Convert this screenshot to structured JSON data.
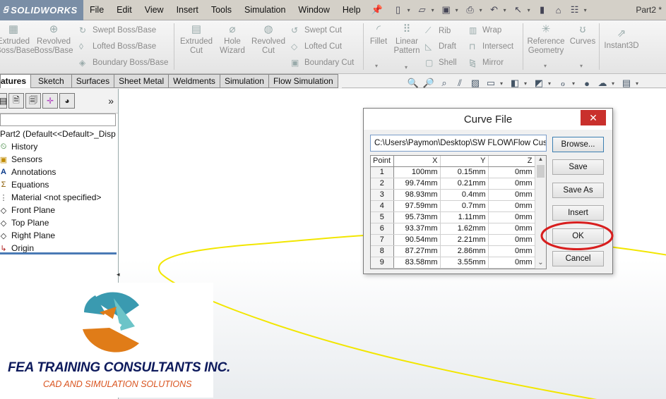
{
  "app": {
    "logo_brand": "SOLIDWORKS",
    "document_title": "Part2 *"
  },
  "menu": [
    "File",
    "Edit",
    "View",
    "Insert",
    "Tools",
    "Simulation",
    "Window",
    "Help"
  ],
  "command_manager": {
    "extruded_boss": "Extruded\nBoss/Base",
    "revolved_boss": "Revolved\nBoss/Base",
    "swept_boss": "Swept Boss/Base",
    "lofted_boss": "Lofted Boss/Base",
    "boundary_boss": "Boundary Boss/Base",
    "extruded_cut": "Extruded\nCut",
    "hole_wizard": "Hole\nWizard",
    "revolved_cut": "Revolved\nCut",
    "swept_cut": "Swept Cut",
    "lofted_cut": "Lofted Cut",
    "boundary_cut": "Boundary Cut",
    "fillet": "Fillet",
    "linear_pattern": "Linear\nPattern",
    "rib": "Rib",
    "draft": "Draft",
    "shell": "Shell",
    "wrap": "Wrap",
    "intersect": "Intersect",
    "mirror": "Mirror",
    "reference_geometry": "Reference\nGeometry",
    "curves": "Curves",
    "instant3d": "Instant3D"
  },
  "tabs": [
    "atures",
    "Sketch",
    "Surfaces",
    "Sheet Metal",
    "Weldments",
    "Simulation",
    "Flow Simulation"
  ],
  "feature_tree": {
    "root": "Part2  (Default<<Default>_Disp",
    "items": [
      "History",
      "Sensors",
      "Annotations",
      "Equations",
      "Material <not specified>",
      "Front Plane",
      "Top Plane",
      "Right Plane",
      "Origin"
    ]
  },
  "dialog": {
    "title": "Curve File",
    "close_glyph": "✕",
    "path": "C:\\Users\\Paymon\\Desktop\\SW FLOW\\Flow Cus",
    "columns": [
      "Point",
      "X",
      "Y",
      "Z"
    ],
    "rows": [
      [
        "1",
        "100mm",
        "0.15mm",
        "0mm"
      ],
      [
        "2",
        "99.74mm",
        "0.21mm",
        "0mm"
      ],
      [
        "3",
        "98.93mm",
        "0.4mm",
        "0mm"
      ],
      [
        "4",
        "97.59mm",
        "0.7mm",
        "0mm"
      ],
      [
        "5",
        "95.73mm",
        "1.11mm",
        "0mm"
      ],
      [
        "6",
        "93.37mm",
        "1.62mm",
        "0mm"
      ],
      [
        "7",
        "90.54mm",
        "2.21mm",
        "0mm"
      ],
      [
        "8",
        "87.27mm",
        "2.86mm",
        "0mm"
      ],
      [
        "9",
        "83.58mm",
        "3.55mm",
        "0mm"
      ]
    ],
    "buttons": {
      "browse": "Browse...",
      "save": "Save",
      "save_as": "Save As",
      "insert": "Insert",
      "ok": "OK",
      "cancel": "Cancel"
    }
  },
  "branding": {
    "company": "FEA TRAINING  CONSULTANTS INC.",
    "tagline": "CAD AND SIMULATION SOLUTIONS"
  },
  "colors": {
    "highlight_circle": "#d81e1e",
    "curve": "#f2e600",
    "close_button": "#c9302c",
    "logo_text": "#0d1a5c",
    "tagline_text": "#d9531e"
  }
}
